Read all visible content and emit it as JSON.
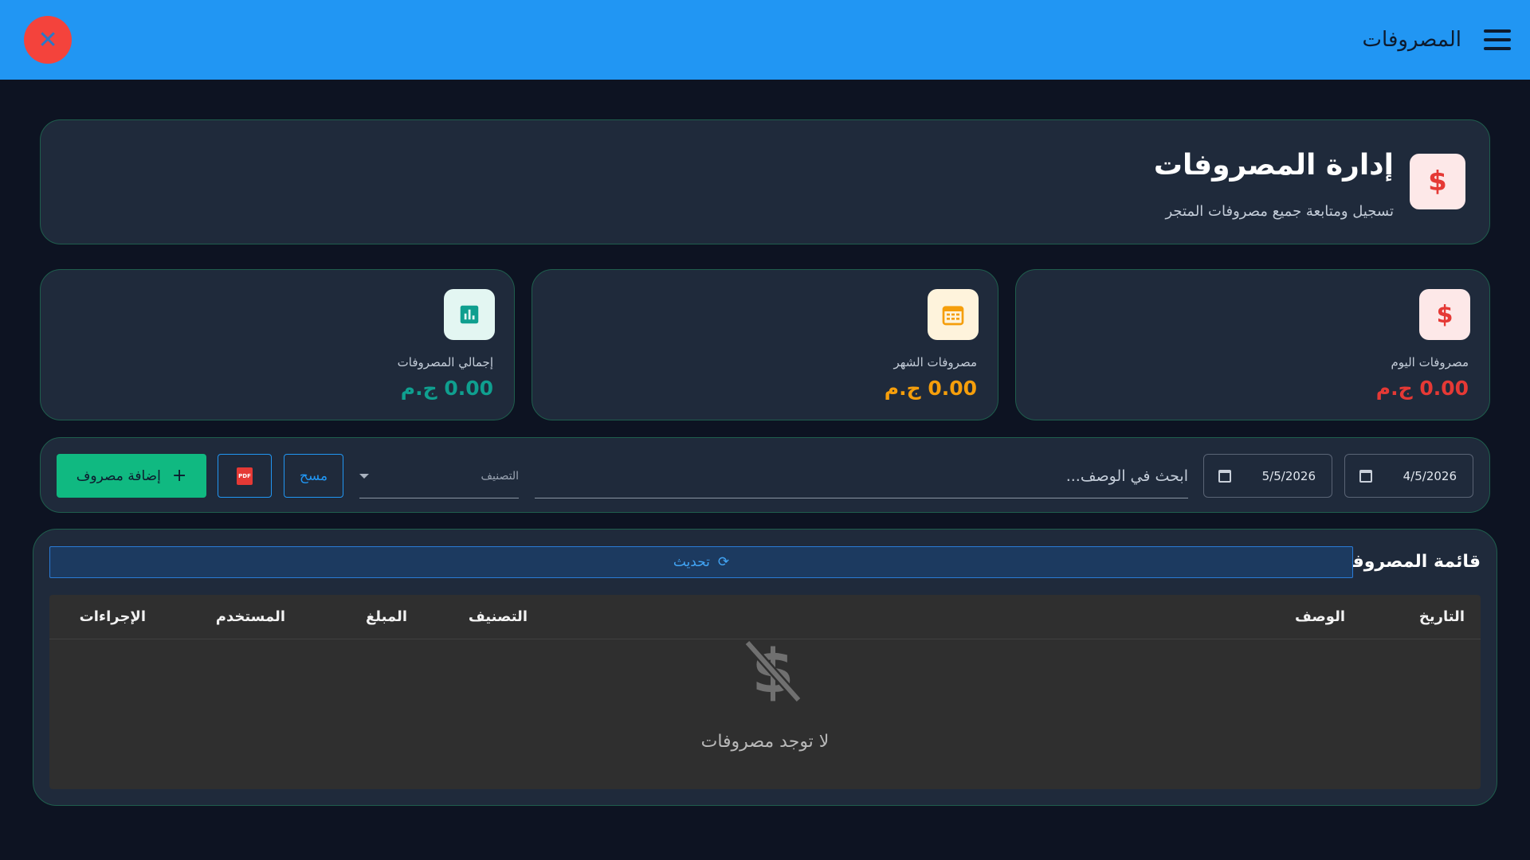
{
  "appbar": {
    "title": "المصروفات",
    "close_symbol": "✕"
  },
  "header": {
    "title": "إدارة المصروفات",
    "subtitle": "تسجيل ومتابعة جميع مصروفات المتجر"
  },
  "stats": [
    {
      "label": "مصروفات اليوم",
      "value": "0.00 ج.م",
      "color": "#e53935",
      "icon": "dollar-icon"
    },
    {
      "label": "مصروفات الشهر",
      "value": "0.00 ج.م",
      "color": "#f59e0b",
      "icon": "calendar-icon"
    },
    {
      "label": "إجمالي المصروفات",
      "value": "0.00 ج.م",
      "color": "#0f9f8f",
      "icon": "bar-chart-icon"
    }
  ],
  "filters": {
    "date_from": "4/5/2026",
    "date_to": "5/5/2026",
    "search_placeholder": "ابحث في الوصف...",
    "category_label": "التصنيف",
    "clear_label": "مسح",
    "pdf_label": "PDF",
    "add_label": "إضافة مصروف"
  },
  "list": {
    "title": "قائمة المصروفات",
    "refresh_label": "تحديث",
    "columns": [
      "التاريخ",
      "الوصف",
      "التصنيف",
      "المبلغ",
      "المستخدم",
      "الإجراءات"
    ],
    "empty_text": "لا توجد مصروفات"
  },
  "colors": {
    "appbar": "#2196f3",
    "accent_green": "#10b981",
    "danger": "#f4433c"
  }
}
